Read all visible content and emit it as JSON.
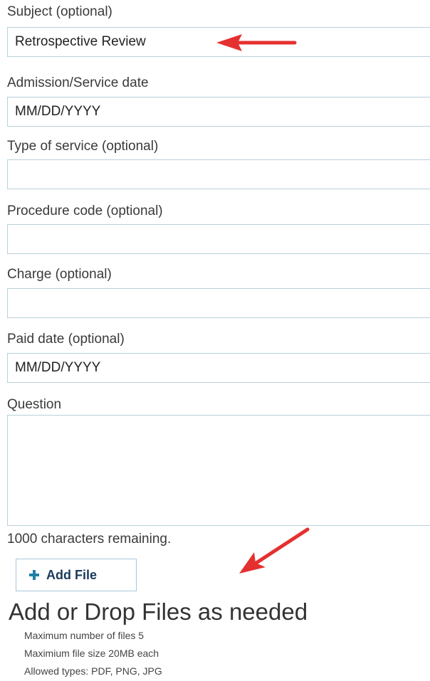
{
  "form": {
    "subject": {
      "label": "Subject (optional)",
      "value": "Retrospective Review"
    },
    "admission_date": {
      "label": "Admission/Service date",
      "placeholder": "MM/DD/YYYY"
    },
    "type_of_service": {
      "label": "Type of service (optional)",
      "value": ""
    },
    "procedure_code": {
      "label": "Procedure code (optional)",
      "value": ""
    },
    "charge": {
      "label": "Charge (optional)",
      "value": ""
    },
    "paid_date": {
      "label": "Paid date (optional)",
      "placeholder": "MM/DD/YYYY"
    },
    "question": {
      "label": "Question",
      "value": "",
      "remaining_text": "1000 characters remaining."
    }
  },
  "attachments": {
    "add_file_label": "Add File",
    "drop_title": "Add or Drop Files as needed",
    "max_files": "Maximum number of files 5",
    "max_size": "Maximium file size 20MB each",
    "allowed_types": "Allowed types: PDF, PNG, JPG"
  },
  "annotations": {
    "arrow_color": "#e53030"
  },
  "icons": {
    "add": "plus-icon"
  }
}
